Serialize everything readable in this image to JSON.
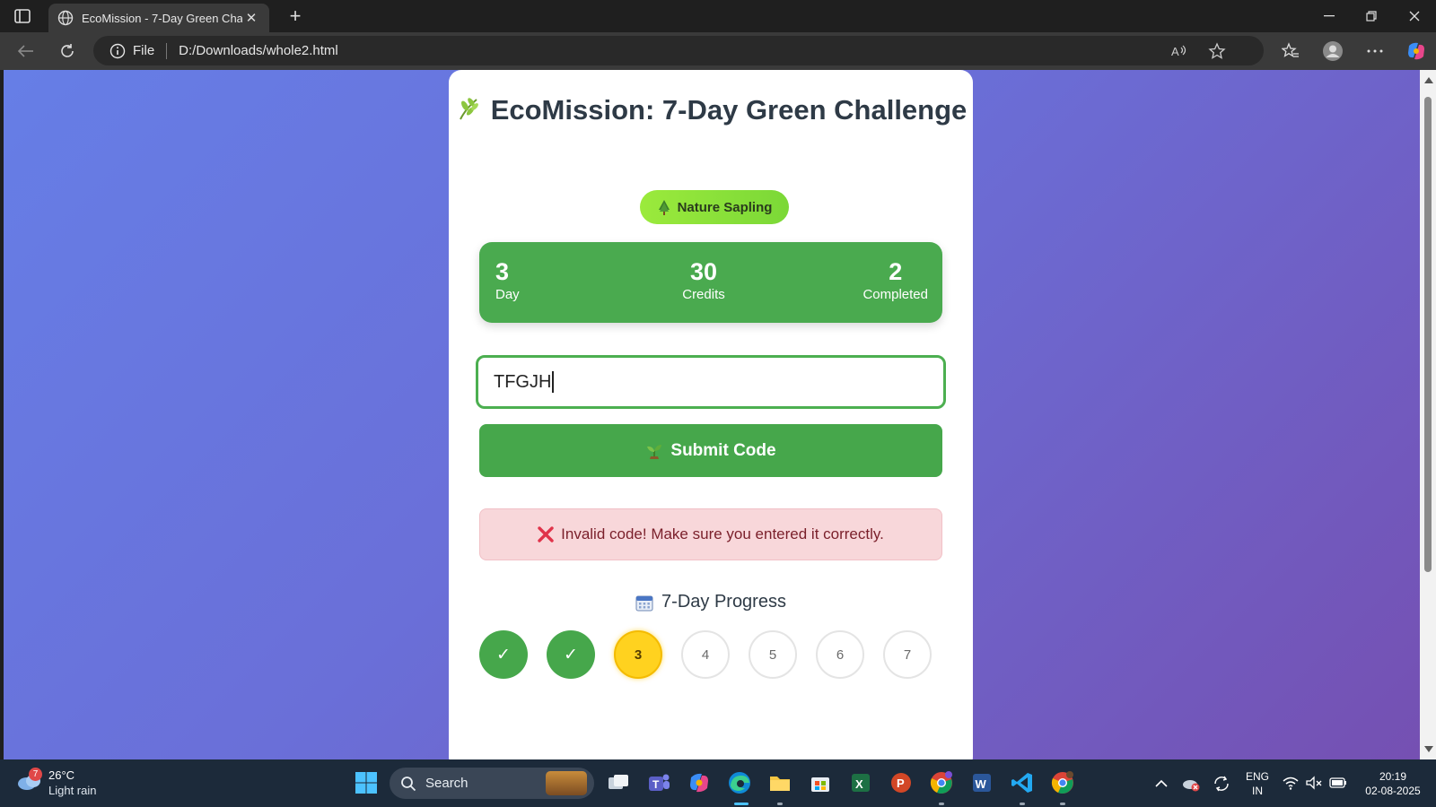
{
  "browser": {
    "tab_title": "EcoMission - 7-Day Green Challenge",
    "tab_close_glyph": "✕",
    "new_tab_glyph": "+",
    "address_scheme": "File",
    "address_url": "D:/Downloads/whole2.html"
  },
  "page": {
    "title": "EcoMission: 7-Day Green Challenge",
    "badge": "Nature Sapling",
    "stats": [
      {
        "value": "3",
        "label": "Day"
      },
      {
        "value": "30",
        "label": "Credits"
      },
      {
        "value": "2",
        "label": "Completed"
      }
    ],
    "code_input_value": "TFGJH",
    "submit_label": "Submit Code",
    "error_message": "Invalid code! Make sure you entered it correctly.",
    "progress_title": "7-Day Progress",
    "days": [
      {
        "label": "✓",
        "state": "done"
      },
      {
        "label": "✓",
        "state": "done"
      },
      {
        "label": "3",
        "state": "current"
      },
      {
        "label": "4",
        "state": "pending"
      },
      {
        "label": "5",
        "state": "pending"
      },
      {
        "label": "6",
        "state": "pending"
      },
      {
        "label": "7",
        "state": "pending"
      }
    ]
  },
  "taskbar": {
    "weather_temp": "26°C",
    "weather_cond": "Light rain",
    "weather_badge": "7",
    "search_label": "Search",
    "lang_line1": "ENG",
    "lang_line2": "IN",
    "time": "20:19",
    "date": "02-08-2025"
  },
  "colors": {
    "accent_green": "#46a74b",
    "error_bg": "#f8d7da",
    "current_day": "#ffd21f"
  }
}
